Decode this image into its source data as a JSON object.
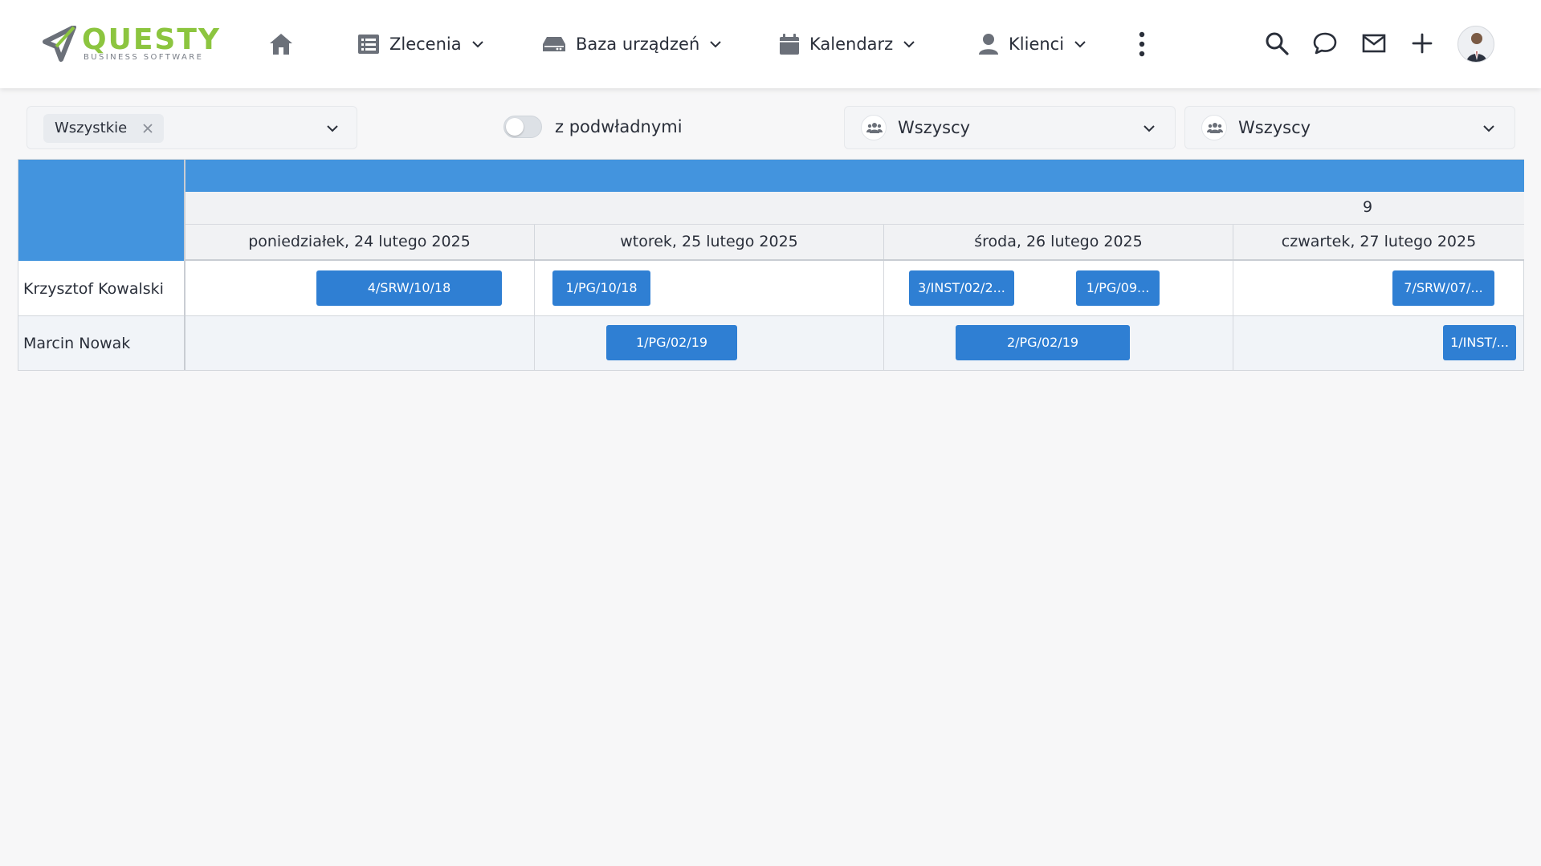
{
  "app": {
    "logo_word": "QUESTY",
    "logo_sub": "BUSINESS SOFTWARE",
    "brand_color": "#8cc53f",
    "accent_color": "#4394de",
    "event_color": "#2f7fd3"
  },
  "nav": {
    "home_icon": "home-icon",
    "items": [
      {
        "label": "Zlecenia",
        "icon": "list-icon"
      },
      {
        "label": "Baza urządzeń",
        "icon": "device-icon"
      },
      {
        "label": "Kalendarz",
        "icon": "calendar-icon"
      },
      {
        "label": "Klienci",
        "icon": "user-icon"
      }
    ],
    "more_icon": "more-vertical-icon",
    "tools": [
      "search-icon",
      "chat-icon",
      "mail-icon",
      "plus-icon"
    ],
    "avatar": "user-avatar"
  },
  "filters": {
    "status_chip": "Wszystkie",
    "toggle_label": "z podwładnymi",
    "toggle_on": false,
    "group_1": "Wszyscy",
    "group_2": "Wszyscy"
  },
  "scheduler": {
    "week_number": "9",
    "days": [
      "poniedziałek, 24 lutego 2025",
      "wtorek, 25 lutego 2025",
      "środa, 26 lutego 2025",
      "czwartek, 27 lutego 2025"
    ],
    "rows": [
      {
        "name": "Krzysztof Kowalski",
        "events": [
          "4/SRW/10/18",
          "1/PG/10/18",
          "3/INST/02/2...",
          "1/PG/09...",
          "7/SRW/07/..."
        ]
      },
      {
        "name": "Marcin Nowak",
        "events": [
          "1/PG/02/19",
          "2/PG/02/19",
          "1/INST/..."
        ]
      }
    ]
  }
}
